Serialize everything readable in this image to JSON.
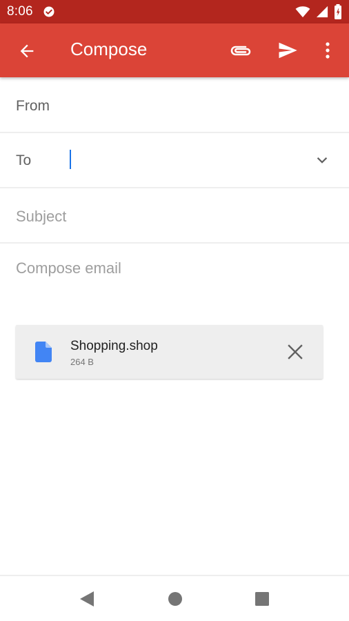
{
  "status_bar": {
    "time": "8:06",
    "icons": [
      "check-circle-icon",
      "wifi-icon",
      "cell-signal-icon",
      "battery-icon"
    ]
  },
  "app_bar": {
    "title": "Compose",
    "background": "#db4437",
    "icons": [
      "back-arrow-icon",
      "paperclip-icon",
      "send-icon",
      "more-vert-icon"
    ]
  },
  "fields": {
    "from_label": "From",
    "to_label": "To",
    "subject_placeholder": "Subject",
    "body_placeholder": "Compose email"
  },
  "attachment": {
    "name": "Shopping.shop",
    "size": "264 B",
    "icon": "file-icon",
    "icon_color": "#4285f4"
  },
  "nav_bar": {
    "icons": [
      "nav-back-icon",
      "nav-home-icon",
      "nav-recents-icon"
    ]
  }
}
